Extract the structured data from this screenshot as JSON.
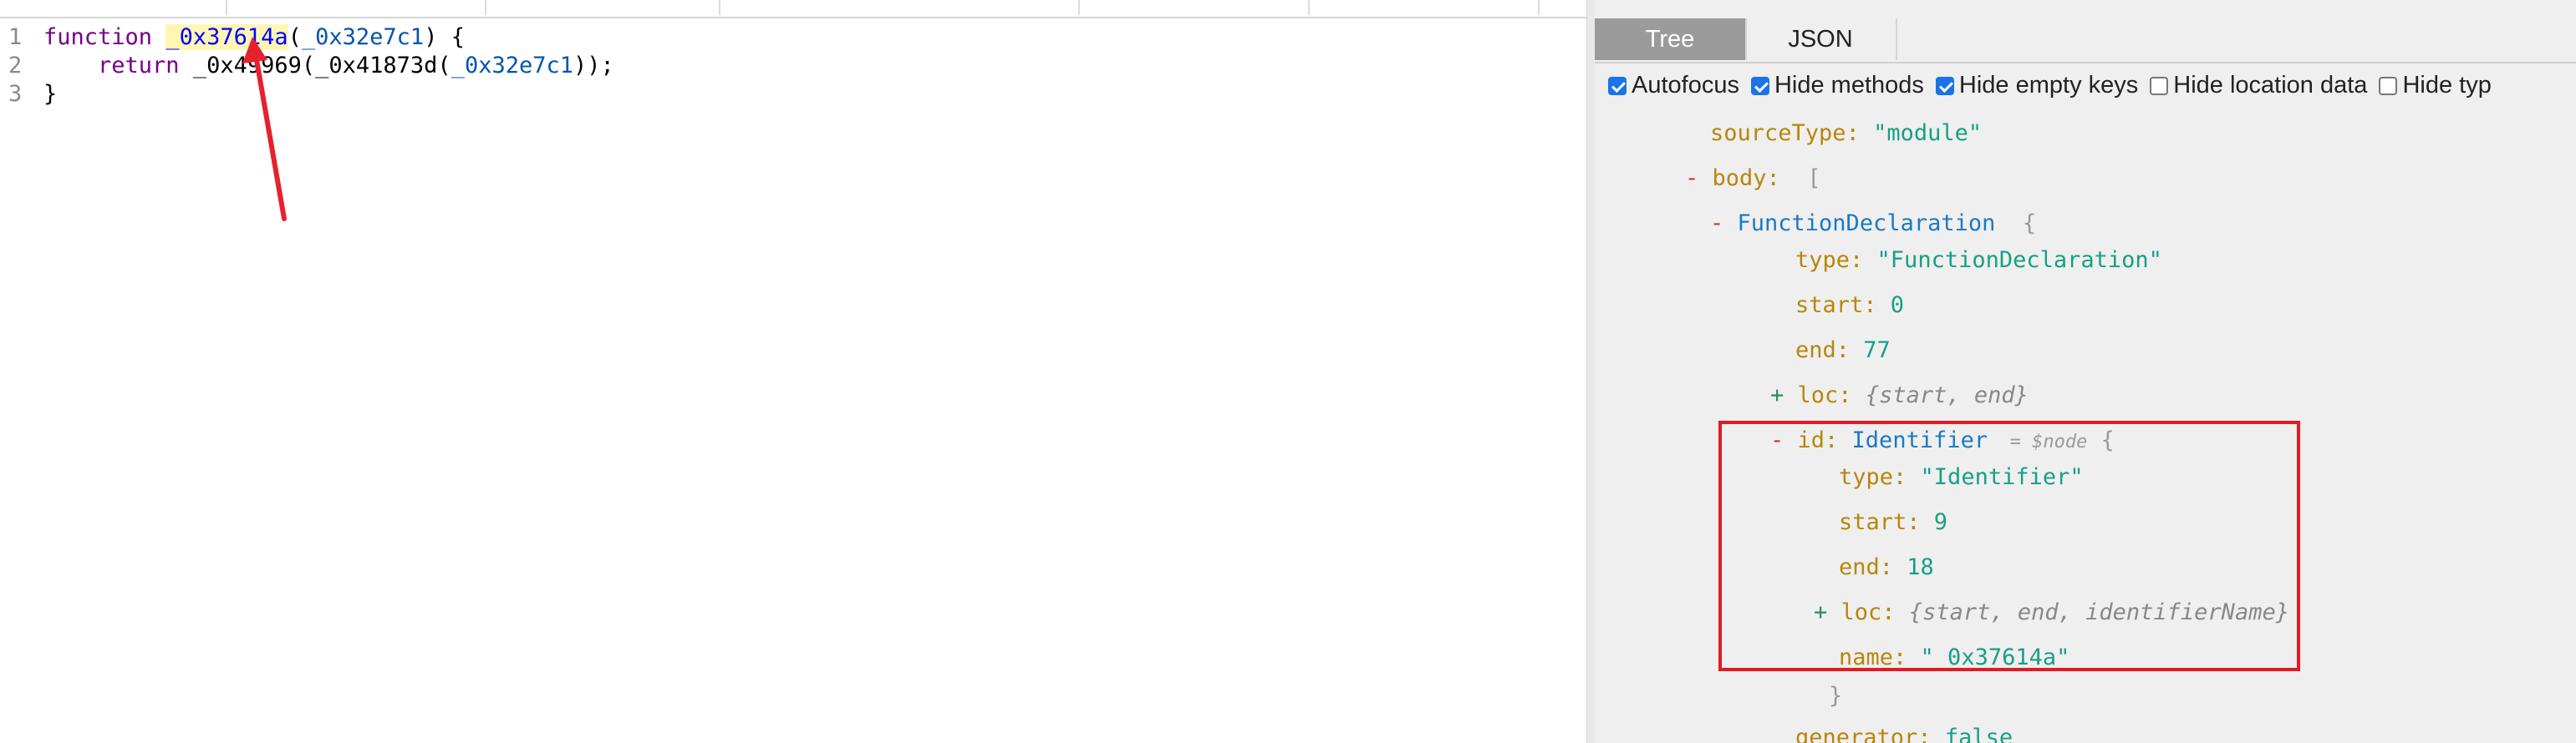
{
  "editor": {
    "lines": [
      {
        "num": "1",
        "parts": [
          {
            "t": "function ",
            "c": "kw"
          },
          {
            "t": "_0x37614a",
            "c": "def"
          },
          {
            "t": "(",
            "c": "plain"
          },
          {
            "t": "_0x32e7c1",
            "c": "var2"
          },
          {
            "t": ") {",
            "c": "plain"
          }
        ]
      },
      {
        "num": "2",
        "parts": [
          {
            "t": "    ",
            "c": "plain"
          },
          {
            "t": "return",
            "c": "kw"
          },
          {
            "t": " _0x4",
            "c": "plain"
          },
          {
            "t": "9969(_0x41873d(",
            "c": "plain"
          },
          {
            "t": "_0x32e7c1",
            "c": "var2"
          },
          {
            "t": "));",
            "c": "plain"
          }
        ]
      },
      {
        "num": "3",
        "parts": [
          {
            "t": "}",
            "c": "plain"
          }
        ]
      }
    ]
  },
  "panel": {
    "tabs": [
      {
        "label": "Tree",
        "active": true
      },
      {
        "label": "JSON",
        "active": false
      }
    ],
    "options": [
      {
        "label": "Autofocus",
        "checked": true
      },
      {
        "label": "Hide methods",
        "checked": true
      },
      {
        "label": "Hide empty keys",
        "checked": true
      },
      {
        "label": "Hide location data",
        "checked": false
      },
      {
        "label": "Hide typ",
        "checked": false
      }
    ],
    "tree": [
      {
        "indent": 0,
        "toggle": "",
        "key": "sourceType",
        "colon": ": ",
        "val": "\"module\"",
        "vc": "str"
      },
      {
        "indent": 0,
        "toggle": "-",
        "key": "body",
        "colon": ":  ",
        "val": "[",
        "vc": "brace"
      },
      {
        "indent": 1,
        "toggle": "-",
        "key": "",
        "colon": "",
        "val": "FunctionDeclaration",
        "vc": "type",
        "after": "  {"
      },
      {
        "indent": 2,
        "toggle": "",
        "key": "type",
        "colon": ": ",
        "val": "\"FunctionDeclaration\"",
        "vc": "str"
      },
      {
        "indent": 2,
        "toggle": "",
        "key": "start",
        "colon": ": ",
        "val": "0",
        "vc": "num"
      },
      {
        "indent": 2,
        "toggle": "",
        "key": "end",
        "colon": ": ",
        "val": "77",
        "vc": "num"
      },
      {
        "indent": 2,
        "toggle": "+",
        "key": "loc",
        "colon": ": ",
        "val": "{start, end}",
        "vc": "summary"
      },
      {
        "indent": 2,
        "toggle": "-",
        "key": "id",
        "colon": ": ",
        "val": "Identifier",
        "vc": "type",
        "ref": "= $node",
        "after": " {"
      },
      {
        "indent": 3,
        "toggle": "",
        "key": "type",
        "colon": ": ",
        "val": "\"Identifier\"",
        "vc": "str"
      },
      {
        "indent": 3,
        "toggle": "",
        "key": "start",
        "colon": ": ",
        "val": "9",
        "vc": "num"
      },
      {
        "indent": 3,
        "toggle": "",
        "key": "end",
        "colon": ": ",
        "val": "18",
        "vc": "num"
      },
      {
        "indent": 3,
        "toggle": "+",
        "key": "loc",
        "colon": ": ",
        "val": "{start, end, identifierName}",
        "vc": "summary"
      },
      {
        "indent": 3,
        "toggle": "",
        "key": "name",
        "colon": ": ",
        "val": "\"_0x37614a\"",
        "vc": "str"
      },
      {
        "indent": 2,
        "toggle": "",
        "key": "",
        "colon": "",
        "val": "}",
        "vc": "brace",
        "close": true
      },
      {
        "indent": 2,
        "toggle": "",
        "key": "generator",
        "colon": ": ",
        "val": "false",
        "vc": "num"
      }
    ]
  },
  "colors": {
    "highlight": "#e01b24",
    "arrow": "#e8202e",
    "active_tab": "#9b9b9b"
  }
}
